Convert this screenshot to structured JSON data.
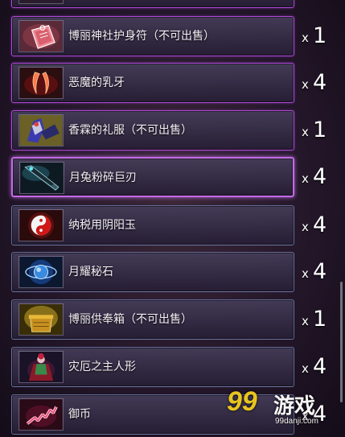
{
  "items": [
    {
      "name": "",
      "quantity": ""
    },
    {
      "name": "博丽神社护身符（不可出售）",
      "quantity": "1"
    },
    {
      "name": "恶魔的乳牙",
      "quantity": "4"
    },
    {
      "name": "香霖的礼服（不可出售）",
      "quantity": "1"
    },
    {
      "name": "月兔粉碎巨刃",
      "quantity": "4"
    },
    {
      "name": "纳税用阴阳玉",
      "quantity": "4"
    },
    {
      "name": "月耀秘石",
      "quantity": "4"
    },
    {
      "name": "博丽供奉箱（不可出售）",
      "quantity": "1"
    },
    {
      "name": "灾厄之主人形",
      "quantity": "4"
    },
    {
      "name": "御币",
      "quantity": "4"
    }
  ],
  "quantity_prefix": "x",
  "selected_item": "月兔粉碎巨刃",
  "colors": {
    "rare_border": "#b04ad8",
    "normal_border": "#96aae6",
    "selected_glow": "#c46ae6"
  },
  "icons": [
    "partial-item-icon",
    "omamori-charm-icon",
    "demon-fangs-icon",
    "robe-icon",
    "greatsword-icon",
    "yin-yang-orb-icon",
    "moon-stone-icon",
    "offering-box-icon",
    "doll-icon",
    "gohei-icon"
  ],
  "watermark": {
    "logo": "99",
    "text": "游戏",
    "url": "99danji.com"
  }
}
